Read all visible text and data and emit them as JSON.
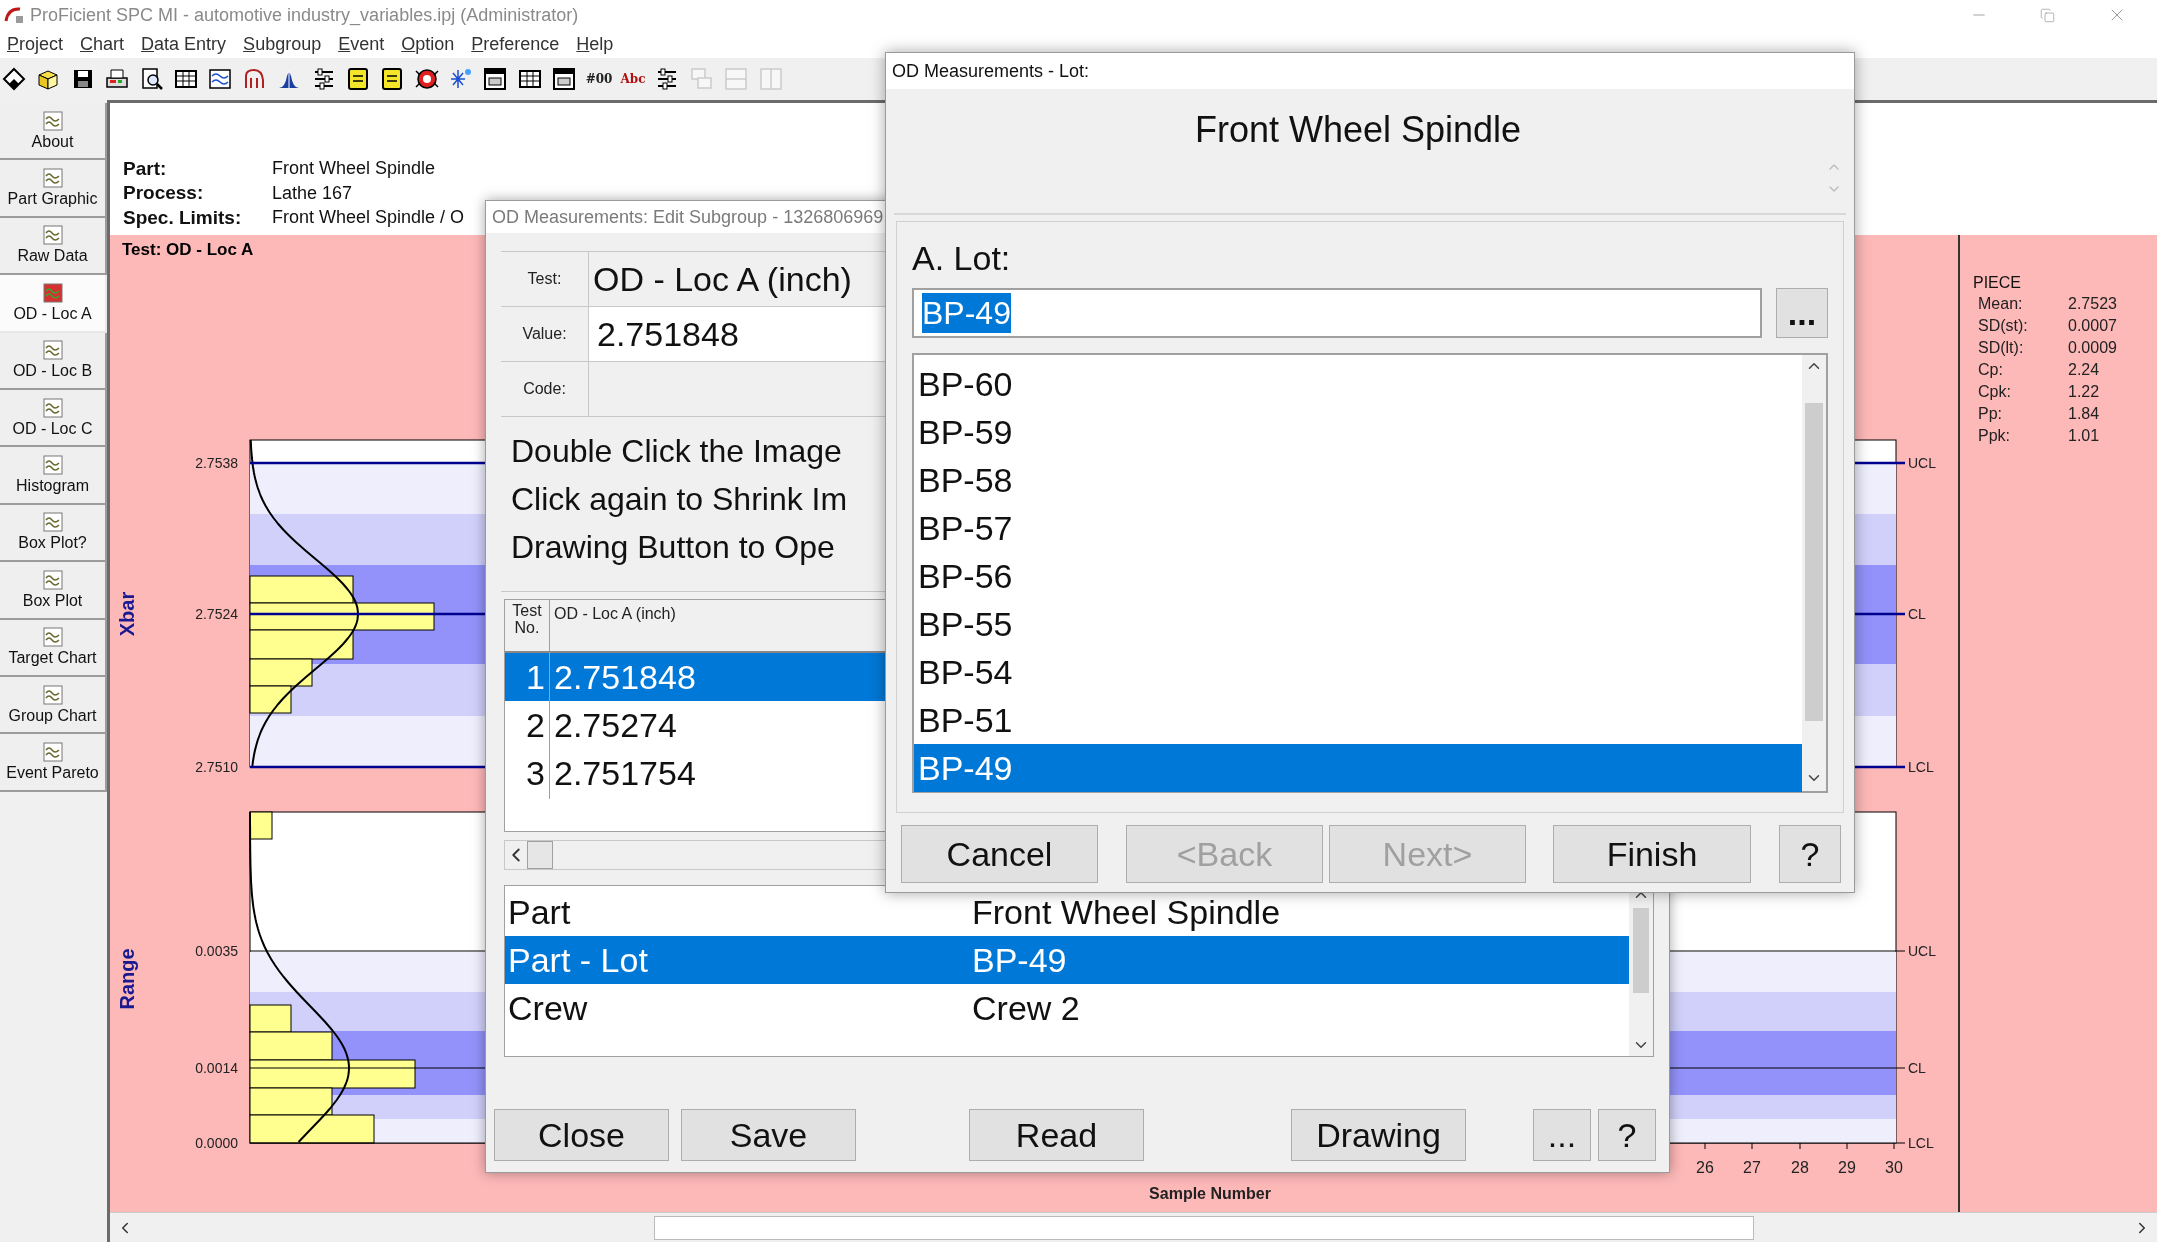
{
  "window": {
    "title": "ProFicient SPC MI - automotive industry_variables.ipj (Administrator)"
  },
  "menu": [
    "Project",
    "Chart",
    "Data Entry",
    "Subgroup",
    "Event",
    "Option",
    "Preference",
    "Help"
  ],
  "toolbar": [
    {
      "kind": "diamond",
      "disabled": false
    },
    {
      "kind": "box",
      "disabled": false
    },
    {
      "kind": "floppy",
      "disabled": false
    },
    {
      "kind": "printer",
      "disabled": false
    },
    {
      "kind": "preview",
      "disabled": false
    },
    {
      "kind": "table",
      "disabled": false
    },
    {
      "kind": "wave",
      "disabled": false
    },
    {
      "kind": "curve",
      "disabled": false
    },
    {
      "kind": "bell",
      "disabled": false
    },
    {
      "kind": "sliders",
      "disabled": false
    },
    {
      "kind": "note",
      "disabled": false
    },
    {
      "kind": "note",
      "disabled": false
    },
    {
      "kind": "target",
      "disabled": false
    },
    {
      "kind": "sparkle",
      "disabled": false
    },
    {
      "kind": "window",
      "disabled": false
    },
    {
      "kind": "table",
      "disabled": false
    },
    {
      "kind": "window",
      "disabled": false
    },
    {
      "kind": "text",
      "glyph": "#00",
      "disabled": false
    },
    {
      "kind": "text",
      "glyph": "Abc",
      "disabled": false
    },
    {
      "kind": "sliders",
      "disabled": false
    },
    {
      "kind": "cascade",
      "disabled": true
    },
    {
      "kind": "rows",
      "disabled": true
    },
    {
      "kind": "columns",
      "disabled": true
    }
  ],
  "sidebar": {
    "items": [
      {
        "label": "About",
        "selected": false
      },
      {
        "label": "Part Graphic",
        "selected": false
      },
      {
        "label": "Raw Data",
        "selected": false
      },
      {
        "label": "OD - Loc A",
        "selected": true
      },
      {
        "label": "OD - Loc B",
        "selected": false
      },
      {
        "label": "OD - Loc C",
        "selected": false
      },
      {
        "label": "Histogram",
        "selected": false
      },
      {
        "label": "Box Plot?",
        "selected": false
      },
      {
        "label": "Box Plot",
        "selected": false
      },
      {
        "label": "Target Chart",
        "selected": false
      },
      {
        "label": "Group Chart",
        "selected": false
      },
      {
        "label": "Event Pareto",
        "selected": false
      }
    ]
  },
  "header": {
    "fields": [
      {
        "label": "Part:",
        "value": "Front Wheel Spindle"
      },
      {
        "label": "Process:",
        "value": "Lathe 167"
      },
      {
        "label": "Spec. Limits:",
        "value": "Front Wheel Spindle / O"
      }
    ]
  },
  "chart": {
    "test_label": "Test: OD - Loc A",
    "xbar": {
      "title": "Xbar",
      "y_ticks": [
        "2.7538",
        "2.7524",
        "2.7510"
      ],
      "limit_labels": [
        "UCL",
        "CL",
        "LCL"
      ]
    },
    "range": {
      "title": "Range",
      "y_ticks": [
        "0.0035",
        "0.0014",
        "0.0000"
      ],
      "limit_labels": [
        "UCL",
        "CL",
        "LCL"
      ]
    },
    "x_ticks": [
      "26",
      "27",
      "28",
      "29",
      "30"
    ],
    "xlabel": "Sample Number"
  },
  "stats": {
    "title": "PIECE",
    "rows": [
      {
        "label": "Mean:",
        "value": "2.7523"
      },
      {
        "label": "SD(st):",
        "value": "0.0007"
      },
      {
        "label": "SD(lt):",
        "value": "0.0009"
      },
      {
        "label": "Cp:",
        "value": "2.24"
      },
      {
        "label": "Cpk:",
        "value": "1.22"
      },
      {
        "label": "Pp:",
        "value": "1.84"
      },
      {
        "label": "Ppk:",
        "value": "1.01"
      }
    ]
  },
  "edit_dialog": {
    "title": "OD Measurements: Edit Subgroup - 1326806969",
    "fields": [
      {
        "label": "Test:",
        "value": "OD - Loc A (inch)",
        "kind": "text"
      },
      {
        "label": "Value:",
        "value": "2.751848",
        "kind": "input"
      },
      {
        "label": "Code:",
        "kind": "input"
      }
    ],
    "instructions": [
      "Double Click the Image",
      "Click again to Shrink Im",
      "Drawing Button to Ope"
    ],
    "table": {
      "columns": [
        "Test No.",
        "OD - Loc A (inch)"
      ],
      "rows": [
        {
          "no": "1",
          "value": "2.751848",
          "selected": true
        },
        {
          "no": "2",
          "value": "2.75274",
          "selected": false
        },
        {
          "no": "3",
          "value": "2.751754",
          "selected": false
        }
      ]
    },
    "attributes": [
      {
        "name": "Part",
        "value": "Front Wheel Spindle",
        "selected": false
      },
      {
        "name": "Part - Lot",
        "value": "BP-49",
        "selected": true
      },
      {
        "name": "Crew",
        "value": "Crew 2",
        "selected": false
      }
    ],
    "buttons": [
      "Close",
      "Save",
      "Read",
      "Drawing",
      "...",
      "?"
    ]
  },
  "lot_dialog": {
    "title": "OD Measurements - Lot:",
    "heading": "Front Wheel Spindle",
    "label": "A. Lot:",
    "input": {
      "value": "BP-49",
      "text_selected": true
    },
    "browse": "...",
    "items": [
      {
        "label": "BP-60",
        "selected": false
      },
      {
        "label": "BP-59",
        "selected": false
      },
      {
        "label": "BP-58",
        "selected": false
      },
      {
        "label": "BP-57",
        "selected": false
      },
      {
        "label": "BP-56",
        "selected": false
      },
      {
        "label": "BP-55",
        "selected": false
      },
      {
        "label": "BP-54",
        "selected": false
      },
      {
        "label": "BP-51",
        "selected": false
      },
      {
        "label": "BP-49",
        "selected": true
      }
    ],
    "buttons": [
      {
        "label": "Cancel",
        "disabled": false
      },
      {
        "label": "<Back",
        "disabled": true
      },
      {
        "label": "Next>",
        "disabled": true
      },
      {
        "label": "Finish",
        "disabled": false
      },
      {
        "label": "?",
        "disabled": false
      }
    ]
  }
}
